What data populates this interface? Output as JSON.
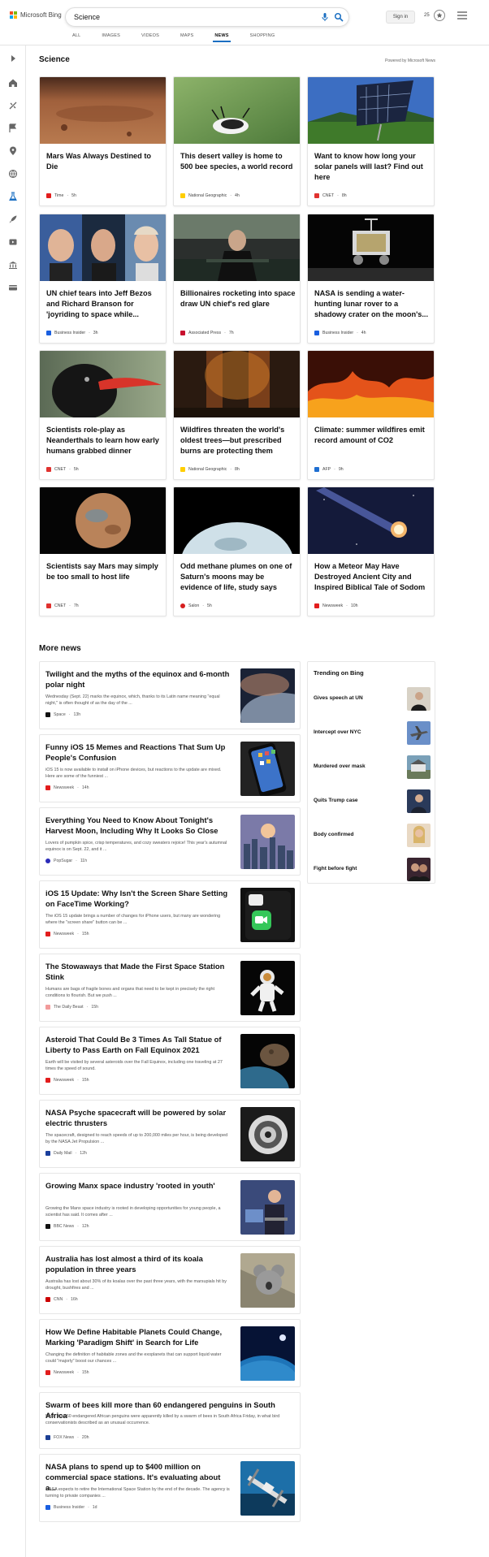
{
  "header": {
    "brand": "Microsoft Bing",
    "search_value": "Science",
    "signin": "Sign in",
    "points": "25",
    "icons": [
      "microphone-icon",
      "search-icon",
      "rewards-icon",
      "menu-icon"
    ]
  },
  "tabs": [
    {
      "label": "ALL"
    },
    {
      "label": "IMAGES"
    },
    {
      "label": "VIDEOS"
    },
    {
      "label": "MAPS"
    },
    {
      "label": "NEWS",
      "active": true
    },
    {
      "label": "SHOPPING"
    }
  ],
  "sidebar_icons": [
    "expand-icon",
    "home-icon",
    "sports-icon",
    "flag-icon",
    "location-icon",
    "world-icon",
    "science-icon",
    "rocket-icon",
    "entertainment-icon",
    "money-icon",
    "card-icon"
  ],
  "science": {
    "title": "Science",
    "powered": "Powered by Microsoft News",
    "cards": [
      {
        "title": "Mars Was Always Destined to Die",
        "source": "Time",
        "age": "5h",
        "brand_color": "#e21d1d"
      },
      {
        "title": "This desert valley is home to 500 bee species, a world record",
        "source": "National Geographic",
        "age": "4h",
        "brand_color": "#ffce00"
      },
      {
        "title": "Want to know how long your solar panels will last? Find out here",
        "source": "CNET",
        "age": "8h",
        "brand_color": "#e0322f"
      },
      {
        "title": "UN chief tears into Jeff Bezos and Richard Branson for 'joyriding to space while...",
        "source": "Business Insider",
        "age": "3h",
        "brand_color": "#1a5fe0"
      },
      {
        "title": "Billionaires rocketing into space draw UN chief's red glare",
        "source": "Associated Press",
        "age": "7h",
        "brand_color": "#c8102e"
      },
      {
        "title": "NASA is sending a water-hunting lunar rover to a shadowy crater on the moon's...",
        "source": "Business Insider",
        "age": "4h",
        "brand_color": "#1a5fe0"
      },
      {
        "title": "Scientists role-play as Neanderthals to learn how early humans grabbed dinner",
        "source": "CNET",
        "age": "5h",
        "brand_color": "#e0322f"
      },
      {
        "title": "Wildfires threaten the world's oldest trees—but prescribed burns are protecting them",
        "source": "National Geographic",
        "age": "8h",
        "brand_color": "#ffce00"
      },
      {
        "title": "Climate: summer wildfires emit record amount of CO2",
        "source": "AFP",
        "age": "9h",
        "brand_color": "#1f6fd1"
      },
      {
        "title": "Scientists say Mars may simply be too small to host life",
        "source": "CNET",
        "age": "7h",
        "brand_color": "#e0322f"
      },
      {
        "title": "Odd methane plumes on one of Saturn's moons may be evidence of life, study says",
        "source": "Salon",
        "age": "5h",
        "brand_color": "#d61f1f"
      },
      {
        "title": "How a Meteor May Have Destroyed Ancient City and Inspired Biblical Tale of Sodom",
        "source": "Newsweek",
        "age": "10h",
        "brand_color": "#e21d1d"
      }
    ]
  },
  "more_news": {
    "title": "More news",
    "items": [
      {
        "title": "Twilight and the myths of the equinox and 6-month polar night",
        "desc": "Wednesday (Sept. 22) marks the equinox, which, thanks to its Latin name meaning \"equal night,\" is often thought of as the day of the ...",
        "source": "Space",
        "age": "13h",
        "brand_color": "#111111"
      },
      {
        "title": "Funny iOS 15 Memes and Reactions That Sum Up People's Confusion",
        "desc": "iOS 15 is now available to install on iPhone devices, but reactions to the update are mixed. Here are some of the funniest ...",
        "source": "Newsweek",
        "age": "14h",
        "brand_color": "#e21d1d"
      },
      {
        "title": "Everything You Need to Know About Tonight's Harvest Moon, Including Why It Looks So Close",
        "desc": "Lovers of pumpkin spice, crisp temperatures, and cozy sweaters rejoice! This year's autumnal equinox is on Sept. 22, and it ...",
        "source": "PopSugar",
        "age": "11h",
        "brand_color": "#2b2bb8"
      },
      {
        "title": "iOS 15 Update: Why Isn't the Screen Share Setting on FaceTime Working?",
        "desc": "The iOS 15 update brings a number of changes for iPhone users, but many are wondering where the \"screen share\" button can be ...",
        "source": "Newsweek",
        "age": "15h",
        "brand_color": "#e21d1d"
      },
      {
        "title": "The Stowaways that Made the First Space Station Stink",
        "desc": "Humans are bags of fragile bones and organs that need to be kept in precisely the right conditions to flourish. But we push ...",
        "source": "The Daily Beast",
        "age": "15h",
        "brand_color": "#f29b9b"
      },
      {
        "title": "Asteroid That Could Be 3 Times As Tall Statue of Liberty to Pass Earth on Fall Equinox 2021",
        "desc": "Earth will be visited by several asteroids over the Fall Equinox, including one traveling at 27 times the speed of sound.",
        "source": "Newsweek",
        "age": "15h",
        "brand_color": "#e21d1d"
      },
      {
        "title": "NASA Psyche spacecraft will be powered by solar electric thrusters",
        "desc": "The spacecraft, designed to reach speeds of up to 200,000 miles per hour, is being developed by the NASA Jet Propulsion ...",
        "source": "Daily Mail",
        "age": "12h",
        "brand_color": "#1a3f9c"
      },
      {
        "title": "Growing Manx space industry 'rooted in youth'",
        "desc": "Growing the Manx space industry is rooted in developing opportunities for young people, a scientist has said. It comes after ...",
        "source": "BBC News",
        "age": "12h",
        "brand_color": "#111111"
      },
      {
        "title": "Australia has lost almost a third of its koala population in three years",
        "desc": "Australia has lost about 30% of its koalas over the past three years, with the marsupials hit by drought, bushfires and ...",
        "source": "CNN",
        "age": "16h",
        "brand_color": "#cc0000"
      },
      {
        "title": "How We Define Habitable Planets Could Change, Marking 'Paradigm Shift' in Search for Life",
        "desc": "Changing the definition of habitable zones and the exoplanets that can support liquid water could \"majorly\" boost our chances ...",
        "source": "Newsweek",
        "age": "15h",
        "brand_color": "#e21d1d"
      },
      {
        "title": "Swarm of bees kill more than 60 endangered penguins in South Africa",
        "desc": "More than 60 endangered African penguins were apparently killed by a swarm of bees in South Africa Friday, in what bird conservationists described as an unusual occurrence.",
        "source": "FOX News",
        "age": "20h",
        "brand_color": "#1c3f94"
      },
      {
        "title": "NASA plans to spend up to $400 million on commercial space stations. It's evaluating about a...",
        "desc": "NASA expects to retire the International Space Station by the end of the decade. The agency is turning to private companies ...",
        "source": "Business Insider",
        "age": "1d",
        "brand_color": "#1a5fe0"
      }
    ]
  },
  "trending": {
    "title": "Trending on Bing",
    "items": [
      {
        "label": "Gives speech at UN"
      },
      {
        "label": "Intercept over NYC"
      },
      {
        "label": "Murdered over mask"
      },
      {
        "label": "Quits Trump case"
      },
      {
        "label": "Body confirmed"
      },
      {
        "label": "Fight before fight"
      }
    ]
  }
}
